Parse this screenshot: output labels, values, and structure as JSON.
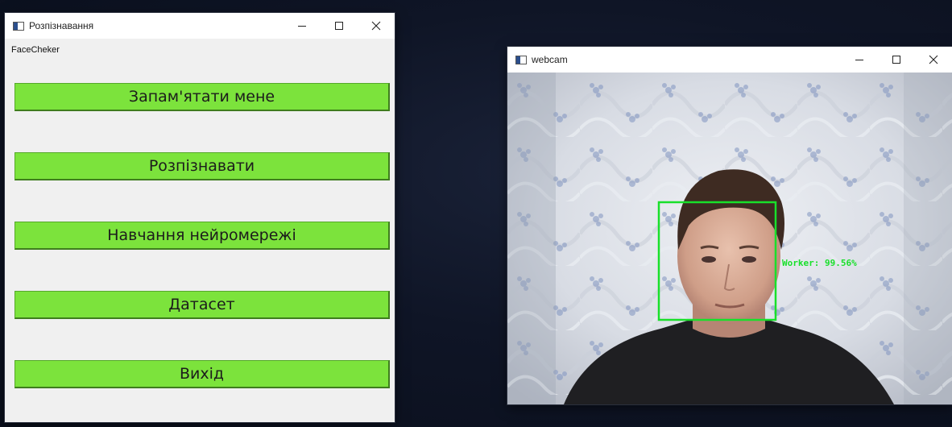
{
  "recog_window": {
    "title": "Розпізнавання",
    "caption": "FaceCheker",
    "buttons": [
      {
        "label": "Запам'ятати мене"
      },
      {
        "label": "Розпізнавати"
      },
      {
        "label": "Навчання нейромережі"
      },
      {
        "label": "Датасет"
      },
      {
        "label": "Вихід"
      }
    ]
  },
  "webcam_window": {
    "title": "webcam",
    "detection": {
      "label": "Worker: 99.56%"
    }
  },
  "icons": {
    "app": "app-window-icon",
    "minimize": "minimize-icon",
    "maximize": "maximize-icon",
    "close": "close-icon"
  },
  "colors": {
    "button_green": "#7ce33c",
    "detection_green": "#18e02a",
    "titlebar": "#ffffff",
    "window_bg": "#f0f0f0"
  }
}
